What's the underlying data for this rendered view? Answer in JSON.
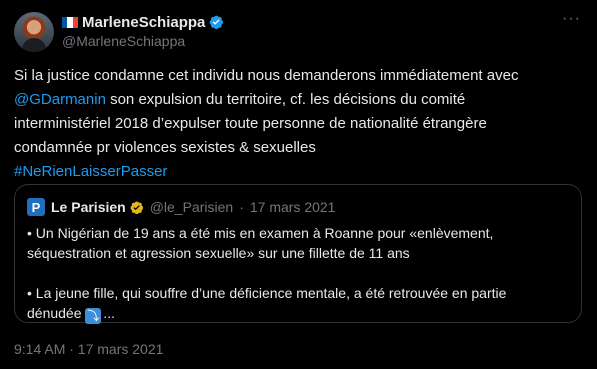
{
  "author": {
    "name": "MarleneSchiappa",
    "handle": "@MarleneSchiappa",
    "flag_colors": [
      "#0055a4",
      "#ffffff",
      "#ef4135"
    ]
  },
  "tweet": {
    "line1": "Si la justice condamne cet individu nous demanderons immédiatement avec",
    "mention": "@GDarmanin",
    "line2_rest": " son expulsion du territoire, cf. les décisions du comité",
    "line3": "interministériel 2018 d’expulser toute personne de nationalité étrangère",
    "line4": "condamnée pr violences sexistes & sexuelles",
    "hashtag": "#NeRienLaisserPasser"
  },
  "quote": {
    "logo_letter": "P",
    "name": "Le Parisien",
    "handle": "@le_Parisien",
    "separator": "·",
    "date": "17 mars 2021",
    "para1_line1": "•  Un Nigérian de 19 ans a été mis en examen à Roanne pour «enlèvement,",
    "para1_line2": "séquestration et agression sexuelle» sur une fillette de 11 ans",
    "para2_line1": "•  La jeune fille, qui souffre d’une déficience mentale, a été retrouvée en partie",
    "para2_line2_text": "dénudée",
    "para2_emoji": "⤵",
    "para2_ellipsis": "..."
  },
  "footer": {
    "timestamp": "9:14 AM · 17 mars 2021"
  },
  "colors": {
    "background": "#000000",
    "text": "#e7e9ea",
    "secondary": "#71767b",
    "link": "#1d9bf0",
    "verified": "#1d9bf0",
    "quote_verified": "#e2b719",
    "border": "#2f3336"
  },
  "icons": {
    "verified": "verified-badge-icon",
    "quote_verified": "gold-verified-badge-icon",
    "more": "more-dots-icon"
  }
}
